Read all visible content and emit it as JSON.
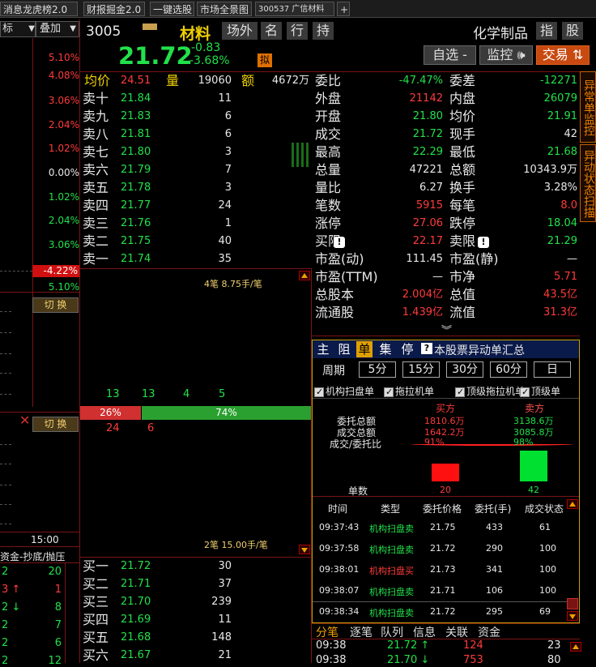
{
  "tabs": [
    "消息龙虎榜2.0",
    "财报掘金2.0",
    "一键选股",
    "市场全景图",
    "300537 广信材料",
    "+"
  ],
  "left": {
    "dropdown1": "标",
    "dropdown2": "叠加",
    "ticks": [
      "5.10%",
      "4.08%",
      "3.06%",
      "2.04%",
      "1.02%",
      "0.00%",
      "1.02%",
      "2.04%",
      "3.06%",
      "-4.22%",
      "5.10%"
    ],
    "switch1": "切 换",
    "switch2": "切 换",
    "time": "15:00",
    "flow_title": "资金-抄底/抛压",
    "flow_rows": [
      {
        "a": "2",
        "b": "20"
      },
      {
        "a": "3 ↑",
        "b": "1"
      },
      {
        "a": "2 ↓",
        "b": "8"
      },
      {
        "a": "2",
        "b": "7"
      },
      {
        "a": "2",
        "b": "6"
      },
      {
        "a": "2",
        "b": "12"
      }
    ]
  },
  "header": {
    "code": "3005",
    "name": "材料",
    "tabs": [
      "场外",
      "名",
      "行",
      "持"
    ],
    "industry": "化学制品",
    "btn_index": "指",
    "btn_stock": "股",
    "price": "21.72",
    "change": "-0.83",
    "change_pct": "-3.68%",
    "badge": "拟",
    "watch": "自选 -",
    "monitor": "监控 🕪",
    "trade": "交易 ⇅"
  },
  "book": {
    "avg_label": "均价",
    "avg": "24.51",
    "vol_label": "量",
    "vol": "19060",
    "amt_label": "额",
    "amt": "4672万",
    "asks": [
      {
        "l": "卖十",
        "p": "21.84",
        "v": "11"
      },
      {
        "l": "卖九",
        "p": "21.83",
        "v": "6"
      },
      {
        "l": "卖八",
        "p": "21.81",
        "v": "6"
      },
      {
        "l": "卖七",
        "p": "21.80",
        "v": "3"
      },
      {
        "l": "卖六",
        "p": "21.79",
        "v": "7"
      },
      {
        "l": "卖五",
        "p": "21.78",
        "v": "3"
      },
      {
        "l": "卖四",
        "p": "21.77",
        "v": "24"
      },
      {
        "l": "卖三",
        "p": "21.76",
        "v": "1"
      },
      {
        "l": "卖二",
        "p": "21.75",
        "v": "40"
      },
      {
        "l": "卖一",
        "p": "21.74",
        "v": "35"
      }
    ],
    "top_note": "4笔 8.75手/笔",
    "counts": [
      "13",
      "13",
      "4",
      "5"
    ],
    "sell_pct": "26%",
    "buy_pct": "74%",
    "sell_pct_value": 26,
    "under": [
      "24",
      "6"
    ],
    "bottom_note": "2笔 15.00手/笔",
    "bids": [
      {
        "l": "买一",
        "p": "21.72",
        "v": "30"
      },
      {
        "l": "买二",
        "p": "21.71",
        "v": "37"
      },
      {
        "l": "买三",
        "p": "21.70",
        "v": "239"
      },
      {
        "l": "买四",
        "p": "21.69",
        "v": "11"
      },
      {
        "l": "买五",
        "p": "21.68",
        "v": "148"
      },
      {
        "l": "买六",
        "p": "21.67",
        "v": "21"
      }
    ]
  },
  "stats": [
    {
      "l1": "委比",
      "v1": "-47.47%",
      "c1": "grn",
      "l2": "委差",
      "v2": "-12271",
      "c2": "grn"
    },
    {
      "l1": "外盘",
      "v1": "21142",
      "c1": "red",
      "l2": "内盘",
      "v2": "26079",
      "c2": "grn"
    },
    {
      "l1": "开盘",
      "v1": "21.80",
      "c1": "grn",
      "l2": "均价",
      "v2": "21.91",
      "c2": "grn"
    },
    {
      "l1": "成交",
      "v1": "21.72",
      "c1": "grn",
      "l2": "现手",
      "v2": "42",
      "c2": "wht"
    },
    {
      "l1": "最高",
      "v1": "22.29",
      "c1": "grn",
      "l2": "最低",
      "v2": "21.68",
      "c2": "grn"
    },
    {
      "l1": "总量",
      "v1": "47221",
      "c1": "wht",
      "l2": "总额",
      "v2": "10343.9万",
      "c2": "wht"
    },
    {
      "l1": "量比",
      "v1": "6.27",
      "c1": "wht",
      "l2": "换手",
      "v2": "3.28%",
      "c2": "wht"
    },
    {
      "l1": "笔数",
      "v1": "5915",
      "c1": "red",
      "l2": "每笔",
      "v2": "8.0",
      "c2": "red"
    },
    {
      "l1": "涨停",
      "v1": "27.06",
      "c1": "red",
      "l2": "跌停",
      "v2": "18.04",
      "c2": "grn"
    },
    {
      "l1": "买限",
      "v1": "22.17",
      "c1": "red",
      "l2": "卖限",
      "v2": "21.29",
      "c2": "grn"
    },
    {
      "l1": "市盈(动)",
      "v1": "111.45",
      "c1": "wht",
      "l2": "市盈(静)",
      "v2": "—",
      "c2": "wht"
    },
    {
      "l1": "市盈(TTM)",
      "v1": "—",
      "c1": "wht",
      "l2": "市净",
      "v2": "5.71",
      "c2": "red"
    },
    {
      "l1": "总股本",
      "v1": "2.004亿",
      "c1": "red",
      "l2": "总值",
      "v2": "43.5亿",
      "c2": "red"
    },
    {
      "l1": "流通股",
      "v1": "1.439亿",
      "c1": "red",
      "l2": "流值",
      "v2": "31.3亿",
      "c2": "red"
    }
  ],
  "side_tabs": [
    "异常单监控",
    "异动状态扫描"
  ],
  "panel": {
    "tabs": [
      "主",
      "阻",
      "单",
      "集",
      "停"
    ],
    "title": "本股票异动单汇总",
    "period_label": "周期",
    "periods": [
      "5分",
      "15分",
      "30分",
      "60分",
      "日"
    ],
    "filters": [
      "机构扫盘单",
      "拖拉机单",
      "顶级拖拉机单",
      "顶级单"
    ],
    "buy_col": "买方",
    "sell_col": "卖方",
    "row_labels": [
      "委托总额",
      "成交总额",
      "成交/委托比"
    ],
    "buy_vals": [
      "1810.6万",
      "1642.2万",
      "91%"
    ],
    "sell_vals": [
      "3138.6万",
      "3085.8万",
      "98%"
    ],
    "count_label": "单数",
    "buy_count": 20,
    "sell_count": 42,
    "table_headers": [
      "时间",
      "类型",
      "委托价格",
      "委托(手)",
      "成交状态"
    ],
    "rows": [
      {
        "t": "09:37:43",
        "k": "机构扫盘卖",
        "p": "21.75",
        "v": "433",
        "s": "61",
        "kc": "grn"
      },
      {
        "t": "09:37:58",
        "k": "机构扫盘卖",
        "p": "21.72",
        "v": "290",
        "s": "100",
        "kc": "grn"
      },
      {
        "t": "09:38:01",
        "k": "机构扫盘买",
        "p": "21.73",
        "v": "341",
        "s": "100",
        "kc": "red"
      },
      {
        "t": "09:38:07",
        "k": "机构扫盘卖",
        "p": "21.71",
        "v": "106",
        "s": "100",
        "kc": "grn"
      },
      {
        "t": "09:38:34",
        "k": "机构扫盘卖",
        "p": "21.72",
        "v": "295",
        "s": "69",
        "kc": "grn"
      }
    ]
  },
  "bottom": {
    "tabs": [
      "分笔",
      "逐笔",
      "队列",
      "信息",
      "关联",
      "资金"
    ],
    "rows": [
      {
        "t": "09:38",
        "p": "21.72 ↑",
        "v": "124",
        "n": "23"
      },
      {
        "t": "09:38",
        "p": "21.70 ↓",
        "v": "753",
        "n": "80"
      }
    ]
  },
  "colors": {
    "up": "#ff3b3b",
    "down": "#22e04a",
    "frame": "#7a1414",
    "accent": "#f0a000"
  }
}
